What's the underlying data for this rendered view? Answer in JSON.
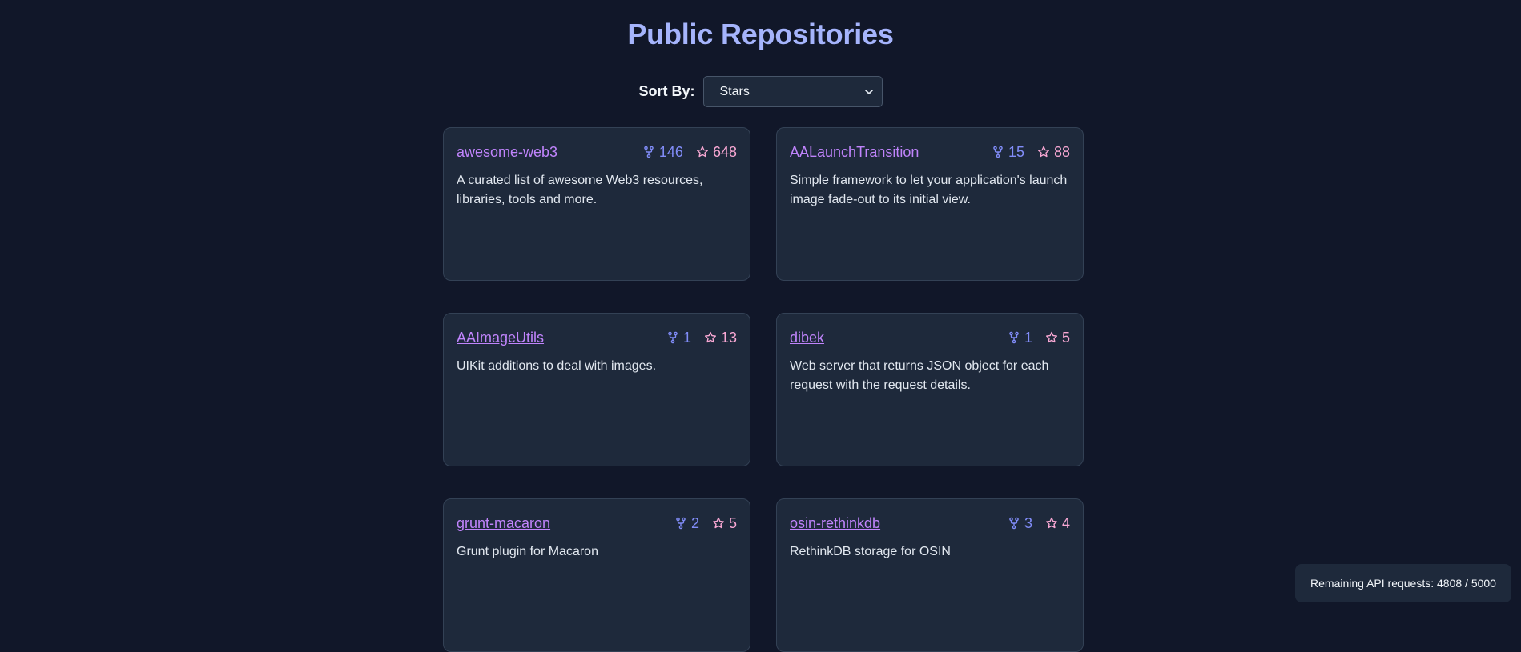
{
  "page": {
    "title": "Public Repositories"
  },
  "sort": {
    "label": "Sort By:",
    "selected": "Stars"
  },
  "repos": [
    {
      "name": "awesome-web3",
      "forks": "146",
      "stars": "648",
      "description": "A curated list of awesome Web3 resources, libraries, tools and more."
    },
    {
      "name": "AALaunchTransition",
      "forks": "15",
      "stars": "88",
      "description": "Simple framework to let your application's launch image fade-out to its initial view."
    },
    {
      "name": "AAImageUtils",
      "forks": "1",
      "stars": "13",
      "description": "UIKit additions to deal with images."
    },
    {
      "name": "dibek",
      "forks": "1",
      "stars": "5",
      "description": "Web server that returns JSON object for each request with the request details."
    },
    {
      "name": "grunt-macaron",
      "forks": "2",
      "stars": "5",
      "description": "Grunt plugin for Macaron"
    },
    {
      "name": "osin-rethinkdb",
      "forks": "3",
      "stars": "4",
      "description": "RethinkDB storage for OSIN"
    }
  ],
  "api": {
    "remaining_text": "Remaining API requests: 4808 / 5000"
  },
  "icons": {
    "fork": "fork-icon",
    "star": "star-icon",
    "chevron": "chevron-down-icon"
  },
  "colors": {
    "background": "#111729",
    "card": "#1e293b",
    "title": "#a5b4fc",
    "link": "#c084fc",
    "forks": "#818cf8",
    "stars": "#f9a8d4"
  }
}
